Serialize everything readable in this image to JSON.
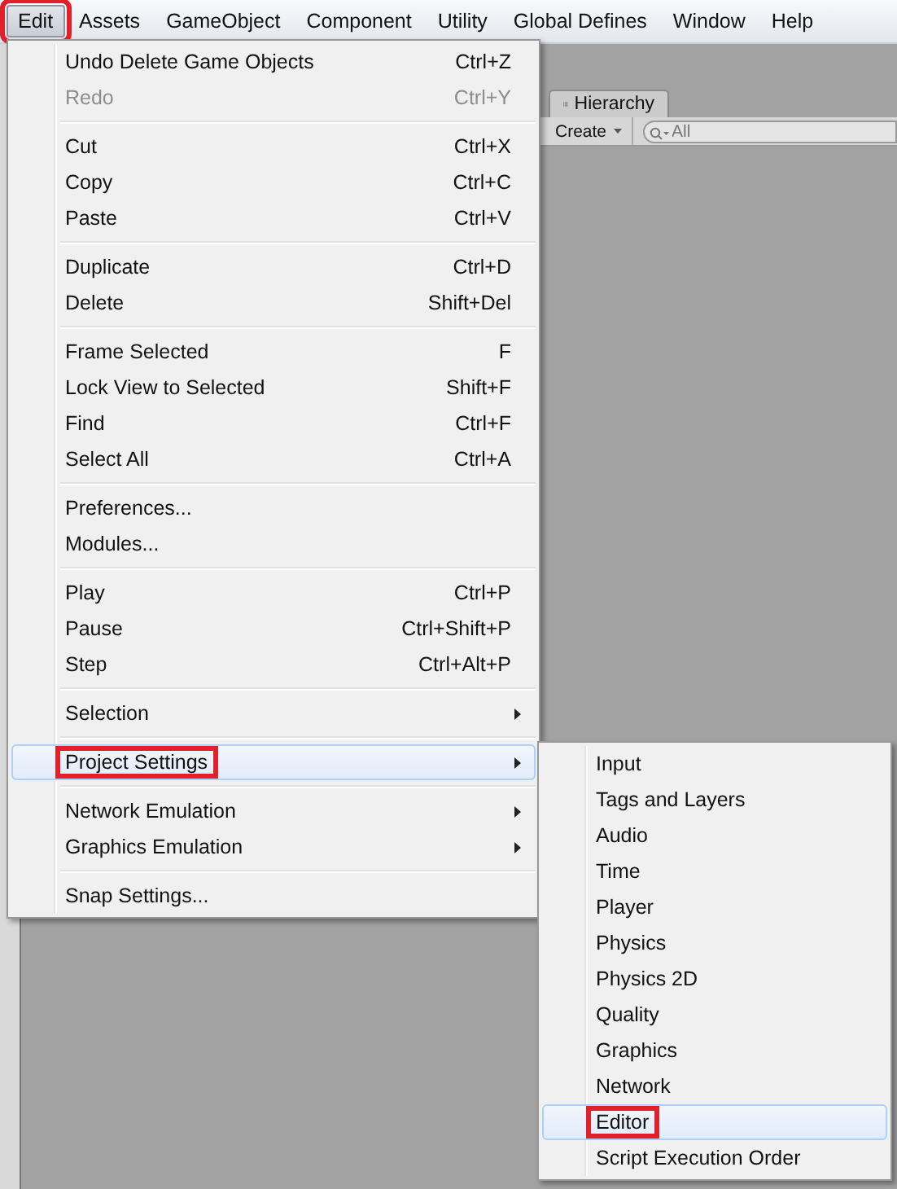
{
  "menubar": [
    {
      "label": "Edit",
      "selected": true,
      "annotated": true
    },
    {
      "label": "Assets",
      "selected": false,
      "annotated": false
    },
    {
      "label": "GameObject",
      "selected": false,
      "annotated": false
    },
    {
      "label": "Component",
      "selected": false,
      "annotated": false
    },
    {
      "label": "Utility",
      "selected": false,
      "annotated": false
    },
    {
      "label": "Global Defines",
      "selected": false,
      "annotated": false
    },
    {
      "label": "Window",
      "selected": false,
      "annotated": false
    },
    {
      "label": "Help",
      "selected": false,
      "annotated": false
    }
  ],
  "hierarchy": {
    "tab": "Hierarchy",
    "create": "Create",
    "search": {
      "placeholder": "All"
    }
  },
  "edit_menu": [
    {
      "kind": "item",
      "label": "Undo Delete Game Objects",
      "shortcut": "Ctrl+Z",
      "disabled": false,
      "selected": false,
      "annotated": false
    },
    {
      "kind": "item",
      "label": "Redo",
      "shortcut": "Ctrl+Y",
      "disabled": true,
      "selected": false,
      "annotated": false
    },
    {
      "kind": "separator"
    },
    {
      "kind": "item",
      "label": "Cut",
      "shortcut": "Ctrl+X",
      "disabled": false,
      "selected": false,
      "annotated": false
    },
    {
      "kind": "item",
      "label": "Copy",
      "shortcut": "Ctrl+C",
      "disabled": false,
      "selected": false,
      "annotated": false
    },
    {
      "kind": "item",
      "label": "Paste",
      "shortcut": "Ctrl+V",
      "disabled": false,
      "selected": false,
      "annotated": false
    },
    {
      "kind": "separator"
    },
    {
      "kind": "item",
      "label": "Duplicate",
      "shortcut": "Ctrl+D",
      "disabled": false,
      "selected": false,
      "annotated": false
    },
    {
      "kind": "item",
      "label": "Delete",
      "shortcut": "Shift+Del",
      "disabled": false,
      "selected": false,
      "annotated": false
    },
    {
      "kind": "separator"
    },
    {
      "kind": "item",
      "label": "Frame Selected",
      "shortcut": "F",
      "disabled": false,
      "selected": false,
      "annotated": false
    },
    {
      "kind": "item",
      "label": "Lock View to Selected",
      "shortcut": "Shift+F",
      "disabled": false,
      "selected": false,
      "annotated": false
    },
    {
      "kind": "item",
      "label": "Find",
      "shortcut": "Ctrl+F",
      "disabled": false,
      "selected": false,
      "annotated": false
    },
    {
      "kind": "item",
      "label": "Select All",
      "shortcut": "Ctrl+A",
      "disabled": false,
      "selected": false,
      "annotated": false
    },
    {
      "kind": "separator"
    },
    {
      "kind": "item",
      "label": "Preferences...",
      "disabled": false,
      "selected": false,
      "annotated": false
    },
    {
      "kind": "item",
      "label": "Modules...",
      "disabled": false,
      "selected": false,
      "annotated": false
    },
    {
      "kind": "separator"
    },
    {
      "kind": "item",
      "label": "Play",
      "shortcut": "Ctrl+P",
      "disabled": false,
      "selected": false,
      "annotated": false
    },
    {
      "kind": "item",
      "label": "Pause",
      "shortcut": "Ctrl+Shift+P",
      "disabled": false,
      "selected": false,
      "annotated": false
    },
    {
      "kind": "item",
      "label": "Step",
      "shortcut": "Ctrl+Alt+P",
      "disabled": false,
      "selected": false,
      "annotated": false
    },
    {
      "kind": "separator"
    },
    {
      "kind": "submenu",
      "label": "Selection",
      "selected": false,
      "annotated": false
    },
    {
      "kind": "separator"
    },
    {
      "kind": "submenu",
      "label": "Project Settings",
      "selected": true,
      "annotated": true
    },
    {
      "kind": "separator"
    },
    {
      "kind": "submenu",
      "label": "Network Emulation",
      "selected": false,
      "annotated": false
    },
    {
      "kind": "submenu",
      "label": "Graphics Emulation",
      "selected": false,
      "annotated": false
    },
    {
      "kind": "separator"
    },
    {
      "kind": "item",
      "label": "Snap Settings...",
      "disabled": false,
      "selected": false,
      "annotated": false
    }
  ],
  "project_settings_menu": [
    {
      "label": "Input",
      "selected": false,
      "annotated": false
    },
    {
      "label": "Tags and Layers",
      "selected": false,
      "annotated": false
    },
    {
      "label": "Audio",
      "selected": false,
      "annotated": false
    },
    {
      "label": "Time",
      "selected": false,
      "annotated": false
    },
    {
      "label": "Player",
      "selected": false,
      "annotated": false
    },
    {
      "label": "Physics",
      "selected": false,
      "annotated": false
    },
    {
      "label": "Physics 2D",
      "selected": false,
      "annotated": false
    },
    {
      "label": "Quality",
      "selected": false,
      "annotated": false
    },
    {
      "label": "Graphics",
      "selected": false,
      "annotated": false
    },
    {
      "label": "Network",
      "selected": false,
      "annotated": false
    },
    {
      "label": "Editor",
      "selected": true,
      "annotated": true
    },
    {
      "label": "Script Execution Order",
      "selected": false,
      "annotated": false
    }
  ]
}
